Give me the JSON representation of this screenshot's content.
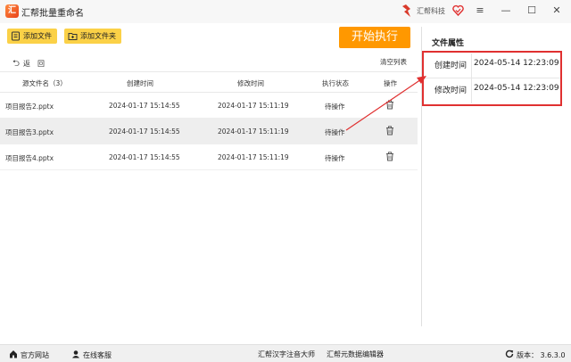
{
  "app": {
    "title": "汇帮批量重命名",
    "logo_char": "汇"
  },
  "brand": {
    "name": "汇帮科技"
  },
  "window_controls": {
    "minimize": "—",
    "maximize": "☐",
    "close": "✕",
    "menu": "≡"
  },
  "toolbar": {
    "add_file": "添加文件",
    "add_folder": "添加文件夹",
    "start": "开始执行"
  },
  "nav": {
    "back": "返　回",
    "clear_list": "清空列表"
  },
  "table": {
    "headers": {
      "name": "源文件名（3）",
      "created": "创建时间",
      "modified": "修改时间",
      "status": "执行状态",
      "action": "操作"
    },
    "rows": [
      {
        "name": "项目报告2.pptx",
        "created": "2024-01-17 15:14:55",
        "modified": "2024-01-17 15:11:19",
        "status": "待操作"
      },
      {
        "name": "项目报告3.pptx",
        "created": "2024-01-17 15:14:55",
        "modified": "2024-01-17 15:11:19",
        "status": "待操作"
      },
      {
        "name": "项目报告4.pptx",
        "created": "2024-01-17 15:14:55",
        "modified": "2024-01-17 15:11:19",
        "status": "待操作"
      }
    ]
  },
  "attributes": {
    "title": "文件属性",
    "created_label": "创建时间",
    "created_value": "2024-05-14 12:23:09",
    "modified_label": "修改时间",
    "modified_value": "2024-05-14 12:23:09"
  },
  "statusbar": {
    "website": "官方网站",
    "support": "在线客服",
    "pinyin_tool": "汇帮汉字注音大师",
    "metadata_tool": "汇帮元数据编辑器",
    "version": "版本：  3.6.3.0"
  },
  "colors": {
    "accent": "#ff9800",
    "button_yellow": "#fbd147",
    "highlight_red": "#e03030"
  }
}
